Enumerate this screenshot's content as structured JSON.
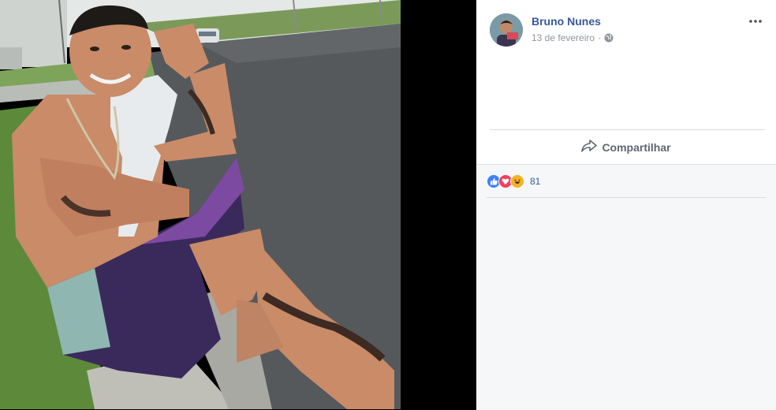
{
  "post": {
    "author_name": "Bruno Nunes",
    "date": "13 de fevereiro",
    "separator": "·",
    "privacy_icon": "globe-icon",
    "more_icon": "more-options-icon"
  },
  "actions": {
    "share_label": "Compartilhar",
    "share_icon": "share-arrow-icon"
  },
  "reactions": {
    "types": [
      "like",
      "love",
      "haha"
    ],
    "count": "81",
    "colors": {
      "like": "#4080ff",
      "love": "#f33e58",
      "haha": "#f7b125"
    }
  },
  "photo": {
    "subject": "photo-image"
  },
  "colors": {
    "link": "#365899",
    "meta": "#90949c",
    "action": "#606770",
    "panel_bg": "#ffffff",
    "footer_bg": "#f6f7f9"
  }
}
